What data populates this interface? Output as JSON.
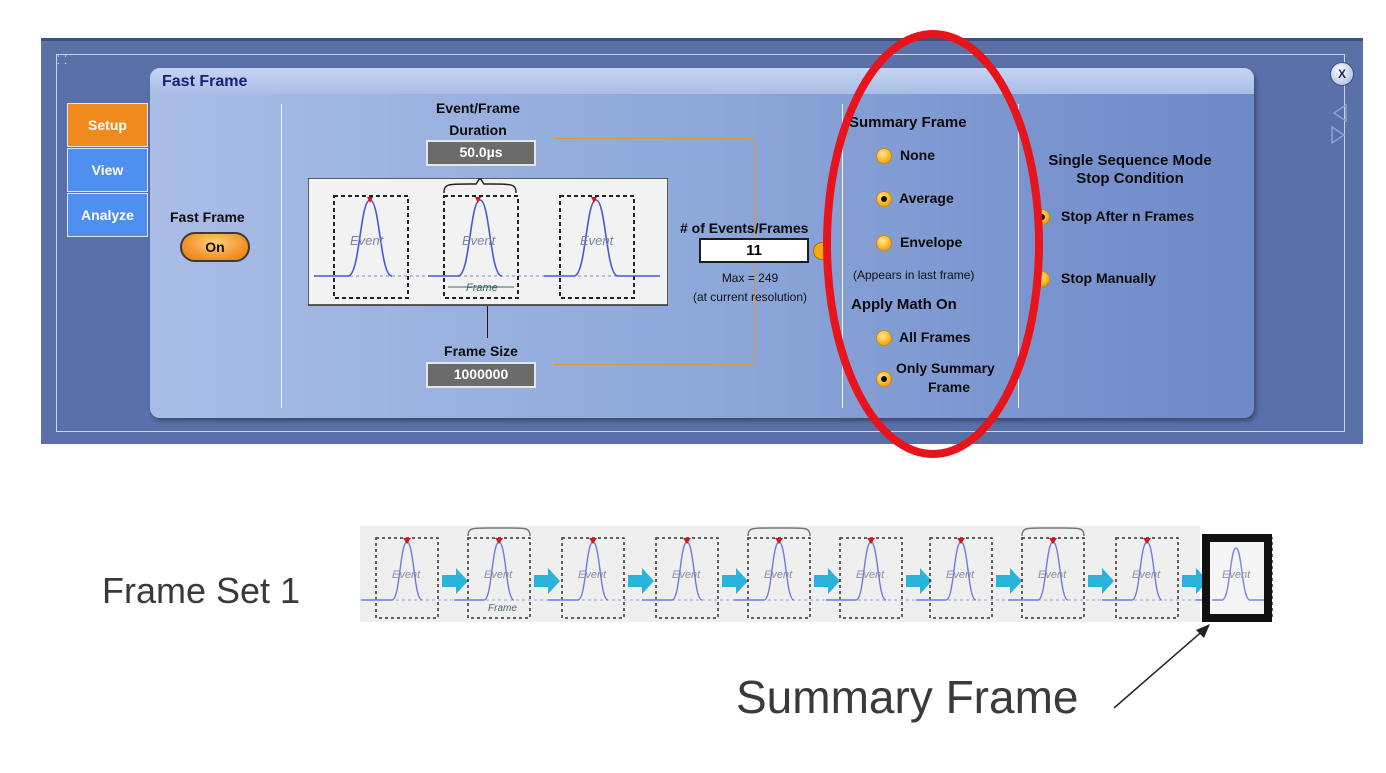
{
  "dialog": {
    "corner_glyph": "⸬",
    "close_label": "X",
    "tabs": [
      {
        "label": "Setup",
        "active": true
      },
      {
        "label": "View",
        "active": false
      },
      {
        "label": "Analyze",
        "active": false
      }
    ],
    "panel_title": "Fast Frame",
    "fast_frame": {
      "label": "Fast Frame",
      "button": "On"
    },
    "event_frame": {
      "label_line1": "Event/Frame",
      "label_line2": "Duration",
      "value": "50.0µs"
    },
    "diagram": {
      "event_label": "Event",
      "frame_label": "Frame"
    },
    "frame_size": {
      "label": "Frame Size",
      "value": "1000000"
    },
    "events": {
      "label": "# of Events/Frames",
      "value": "11",
      "max": "Max = 249",
      "note": "(at current resolution)"
    },
    "summary_frame": {
      "heading": "Summary Frame",
      "options": [
        {
          "label": "None",
          "selected": false
        },
        {
          "label": "Average",
          "selected": true
        },
        {
          "label": "Envelope",
          "selected": false
        }
      ],
      "note": "(Appears in last frame)"
    },
    "apply_math": {
      "heading": "Apply Math On",
      "options": [
        {
          "label": "All Frames",
          "selected": false
        },
        {
          "label": "Only Summary",
          "label2": "Frame",
          "selected": true
        }
      ]
    },
    "single_sequence": {
      "heading_line1": "Single Sequence Mode",
      "heading_line2": "Stop Condition",
      "options": [
        {
          "label": "Stop After n Frames",
          "selected": true
        },
        {
          "label": "Stop Manually",
          "selected": false
        }
      ]
    }
  },
  "lower": {
    "frame_set_label": "Frame Set 1",
    "summary_label": "Summary Frame",
    "event_label": "Event",
    "frame_label": "Frame"
  },
  "colors": {
    "highlight": "#e8141c",
    "arrow": "#2ab4dc",
    "tab_active": "#f08a1d",
    "tab": "#4f8ff0",
    "waveform": "#4a56d8"
  }
}
